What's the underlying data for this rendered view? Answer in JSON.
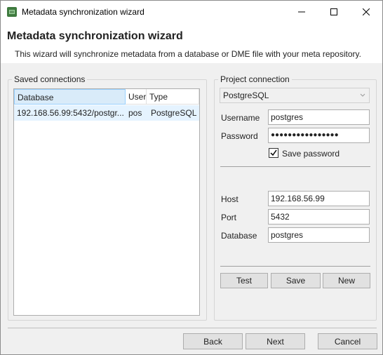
{
  "window": {
    "title": "Metadata synchronization wizard",
    "controls": {
      "minimize": "minimize",
      "maximize": "maximize",
      "close": "close"
    }
  },
  "header": {
    "title": "Metadata synchronization wizard",
    "description": "This wizard will synchronize metadata from a database or DME file with your meta repository."
  },
  "saved_connections": {
    "label": "Saved connections",
    "columns": [
      "Database",
      "User",
      "Type"
    ],
    "rows": [
      {
        "database": "192.168.56.99:5432/postgr...",
        "user": "pos",
        "type": "PostgreSQL"
      }
    ]
  },
  "project_connection": {
    "label": "Project connection",
    "db_type": "PostgreSQL",
    "username_label": "Username",
    "username_value": "postgres",
    "password_label": "Password",
    "password_value": "●●●●●●●●●●●●●●●●",
    "save_password_label": "Save password",
    "save_password_checked": true,
    "host_label": "Host",
    "host_value": "192.168.56.99",
    "port_label": "Port",
    "port_value": "5432",
    "database_label": "Database",
    "database_value": "postgres",
    "buttons": {
      "test": "Test",
      "save": "Save",
      "new": "New"
    }
  },
  "footer": {
    "back": "Back",
    "next": "Next",
    "cancel": "Cancel"
  },
  "colors": {
    "selection": "#e5f3ff",
    "active_header": "#d9ebf9",
    "button_face": "#e1e1e1"
  }
}
